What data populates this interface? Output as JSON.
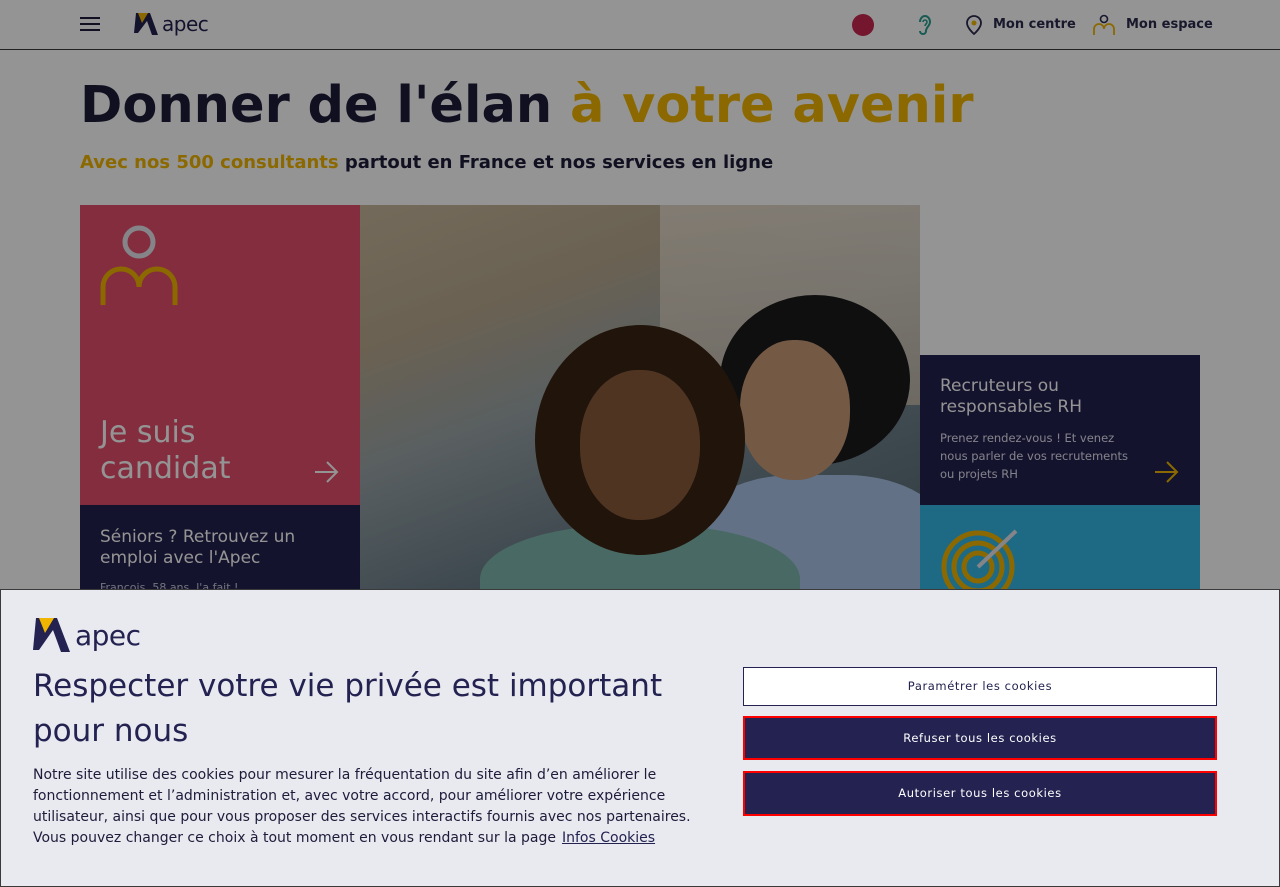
{
  "header": {
    "logo_text": "apec",
    "menu_icon": "hamburger-icon",
    "crown_icon": "crown-icon",
    "accessibility_icon": "ear-icon",
    "centre_label": "Mon centre",
    "espace_label": "Mon espace"
  },
  "hero": {
    "title_main": "Donner de l'élan ",
    "title_accent": "à votre avenir",
    "subtitle_accent": "Avec nos 500 consultants",
    "subtitle_rest": " partout en France et nos services en ligne"
  },
  "cards": {
    "candidat_title": "Je suis candidat",
    "seniors_title": "Séniors ? Retrouvez un emploi avec l'Apec",
    "seniors_sub": "François, 58 ans, l'a fait !",
    "rh_title": "Recruteurs ou responsables RH",
    "rh_sub": "Prenez rendez-vous ! Et venez nous parler de vos recrutements ou projets RH"
  },
  "cookie": {
    "logo_text": "apec",
    "title": "Respecter votre vie privée est important pour nous",
    "body": "Notre site utilise des cookies pour mesurer la fréquentation du site afin d’en améliorer le fonctionnement et l’administration et, avec votre accord, pour améliorer votre expérience utilisateur, ainsi que pour vous proposer des services interactifs fournis avec nos partenaires. Vous pouvez changer ce choix à tout moment en vous rendant sur la page",
    "link": "Infos Cookies",
    "btn_param": "Paramétrer les cookies",
    "btn_refuse": "Refuser tous les cookies",
    "btn_accept": "Autoriser tous les cookies"
  },
  "colors": {
    "brand_navy": "#232250",
    "brand_yellow": "#f0b500",
    "candidat_red": "#e34e6c",
    "target_blue": "#35b7e3",
    "highlight_border": "#ff0000"
  }
}
